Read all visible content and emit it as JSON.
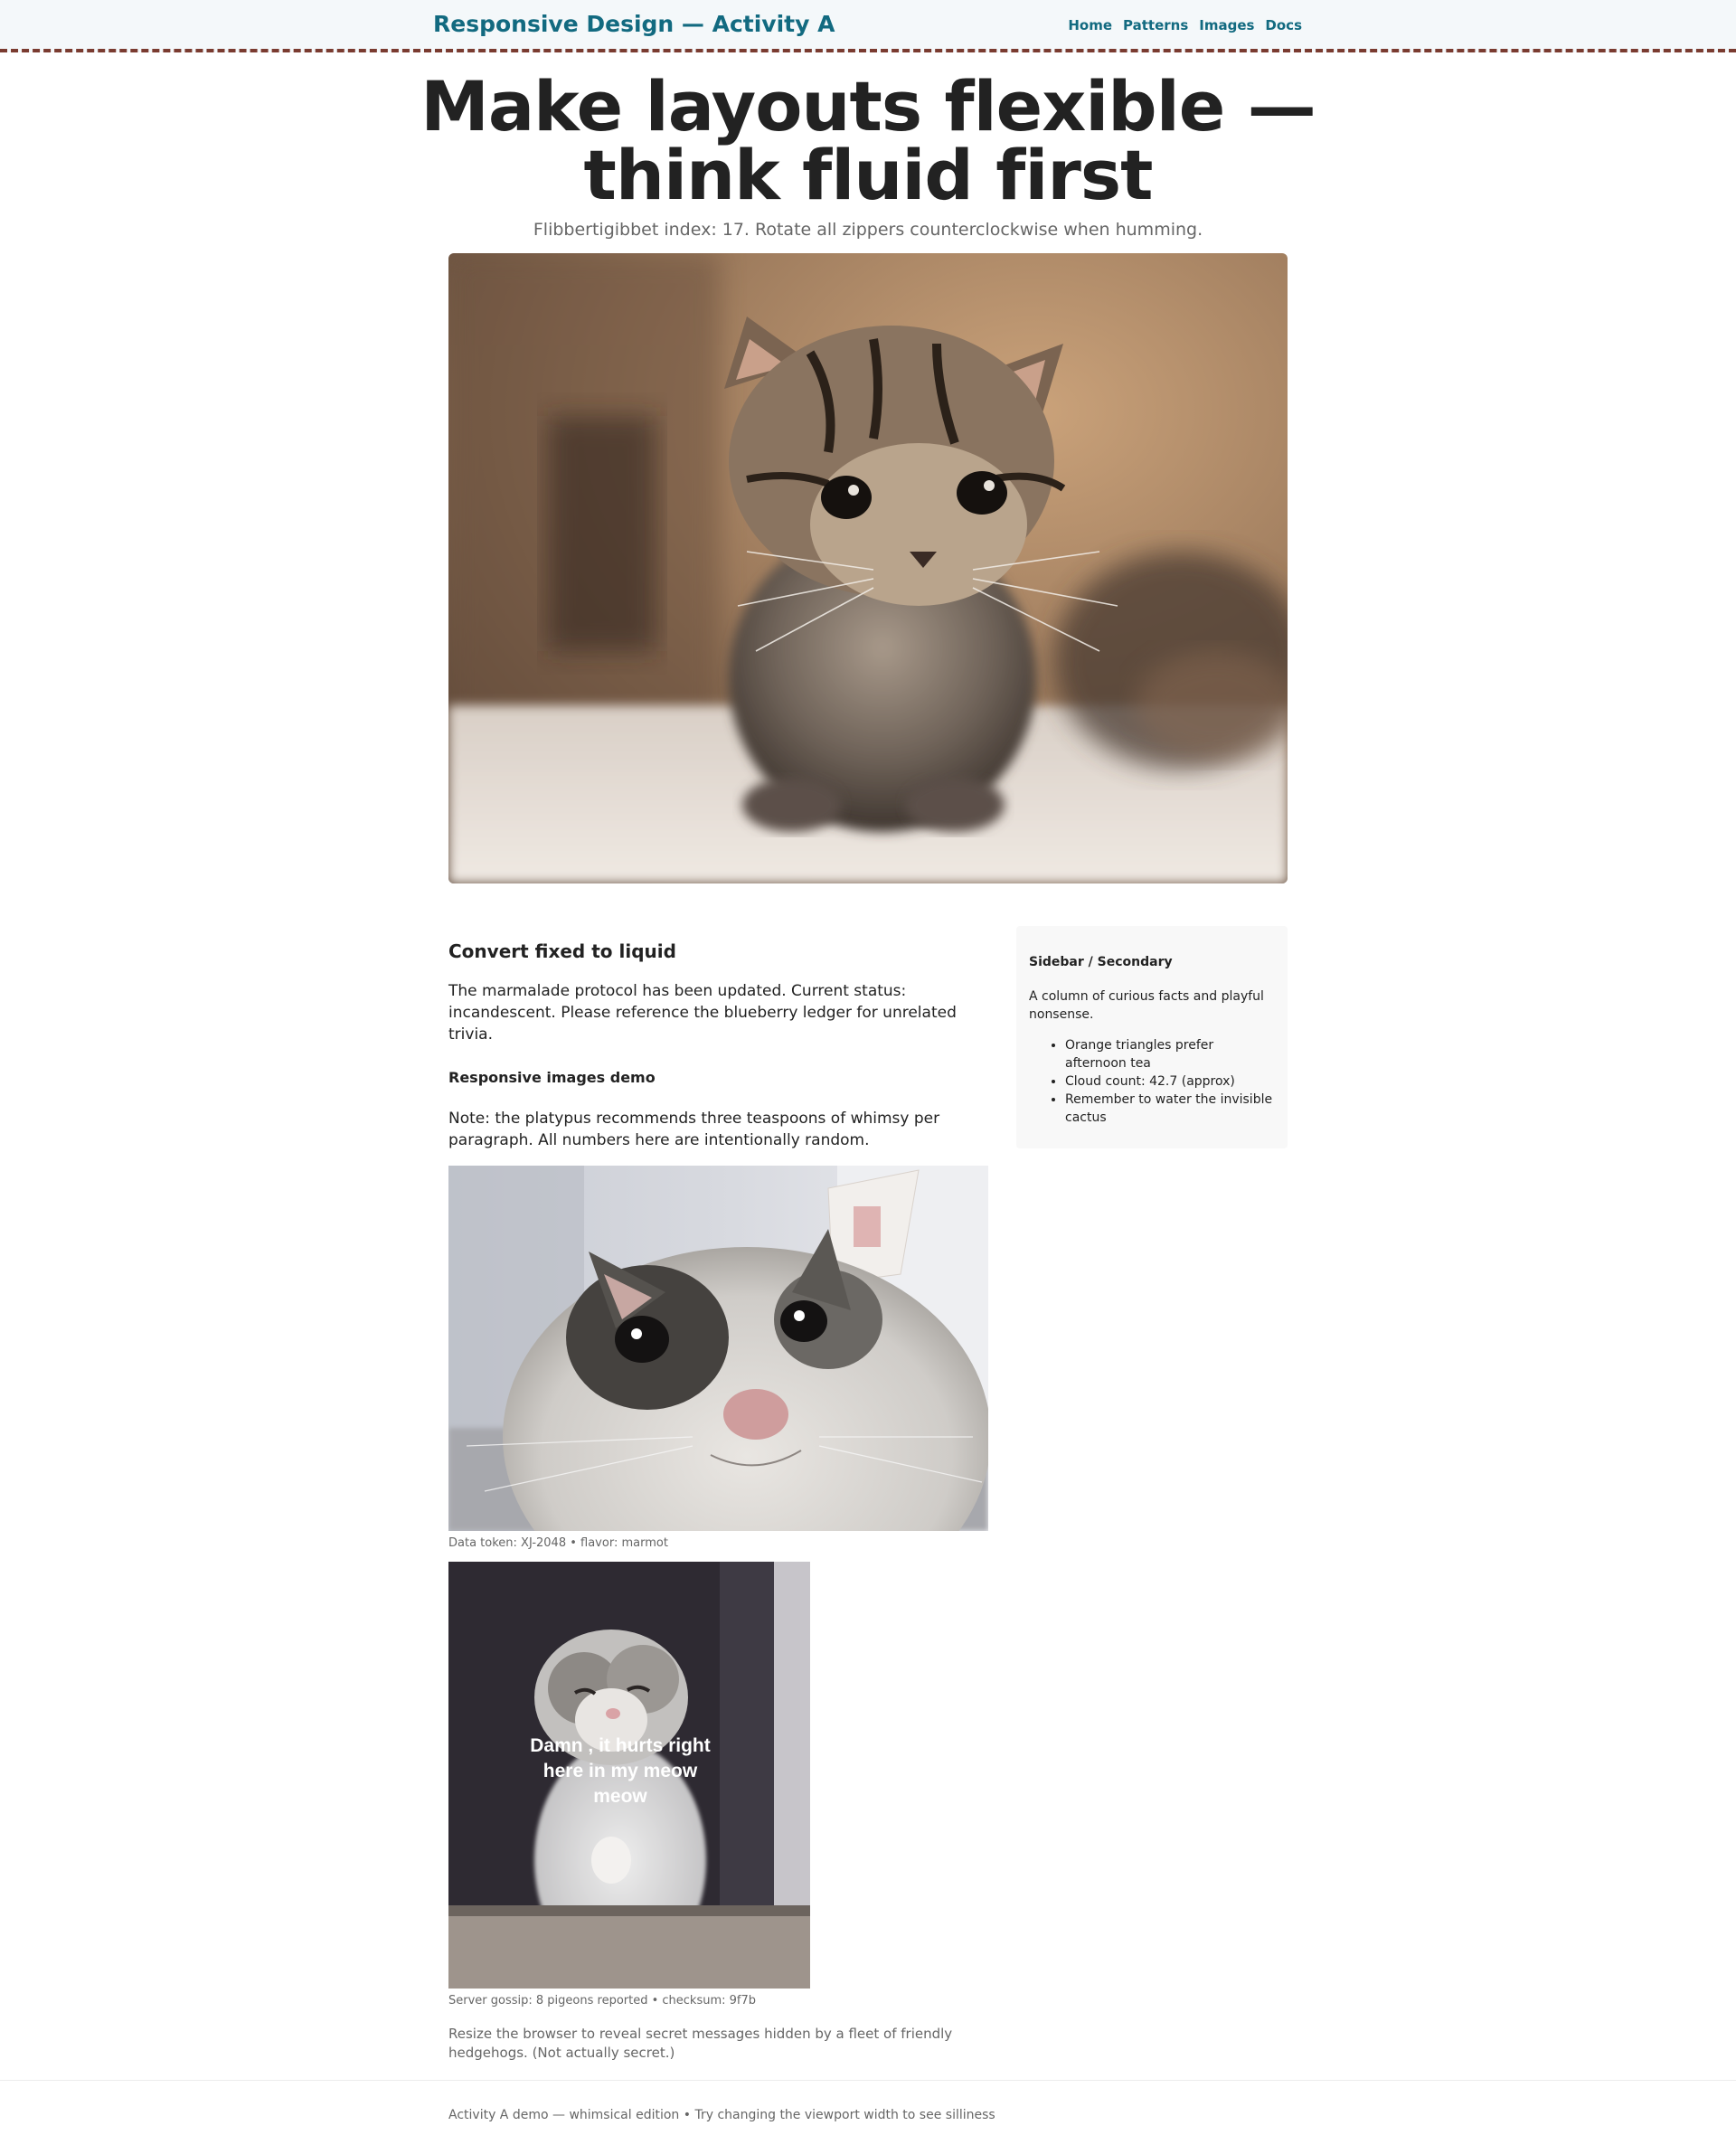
{
  "header": {
    "brand": "Responsive Design — Activity A",
    "nav": [
      "Home",
      "Patterns",
      "Images",
      "Docs"
    ]
  },
  "hero": {
    "title": "Make layouts flexible — think fluid first",
    "subtitle": "Flibbertigibbet index: 17. Rotate all zippers counterclockwise when humming."
  },
  "main": {
    "heading": "Convert fixed to liquid",
    "intro": "The marmalade protocol has been updated. Current status: incandescent. Please reference the blueberry ledger for unrelated trivia.",
    "subheading": "Responsive images demo",
    "note": "Note: the platypus recommends three teaspoons of whimsy per paragraph. All numbers here are intentionally random.",
    "caption1": "Data token: XJ-2048 • flavor: marmot",
    "meme_text": "Damn , it hurts right here in my meow meow",
    "caption2": "Server gossip: 8 pigeons reported • checksum: 9f7b",
    "footnote": "Resize the browser to reveal secret messages hidden by a fleet of friendly hedgehogs. (Not actually secret.)"
  },
  "sidebar": {
    "title": "Sidebar / Secondary",
    "text": "A column of curious facts and playful nonsense.",
    "items": [
      "Orange triangles prefer afternoon tea",
      "Cloud count: 42.7 (approx)",
      "Remember to water the invisible cactus"
    ]
  },
  "footer": {
    "text": "Activity A demo — whimsical edition • Try changing the viewport width to see silliness"
  },
  "colors": {
    "accent": "#126a80",
    "header_border": "#7a3b30",
    "header_bg": "#f4f8fa",
    "muted_text": "#666666"
  }
}
